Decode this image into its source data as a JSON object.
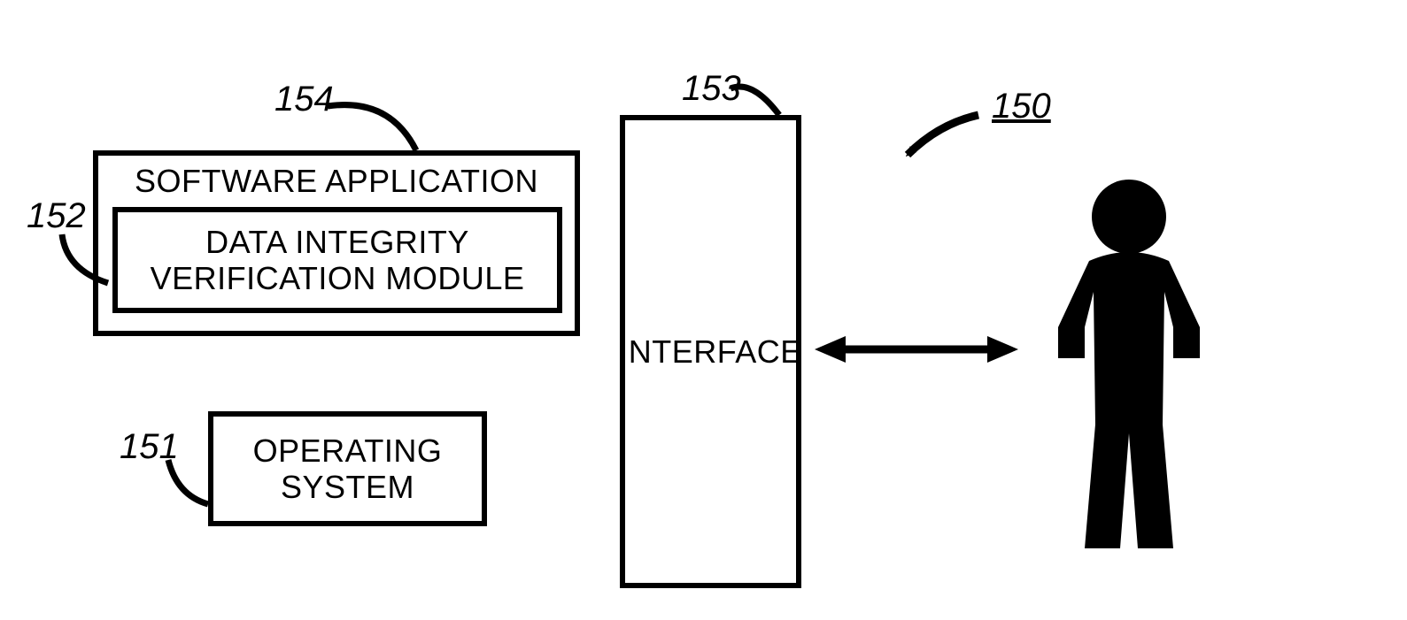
{
  "labels": {
    "ref150": "150",
    "ref151": "151",
    "ref152": "152",
    "ref153": "153",
    "ref154": "154"
  },
  "blocks": {
    "softwareApplication": "SOFTWARE APPLICATION",
    "dataIntegrityLine1": "DATA INTEGRITY",
    "dataIntegrityLine2": "VERIFICATION MODULE",
    "operatingLine1": "OPERATING",
    "operatingLine2": "SYSTEM",
    "interface": "INTERFACE"
  }
}
